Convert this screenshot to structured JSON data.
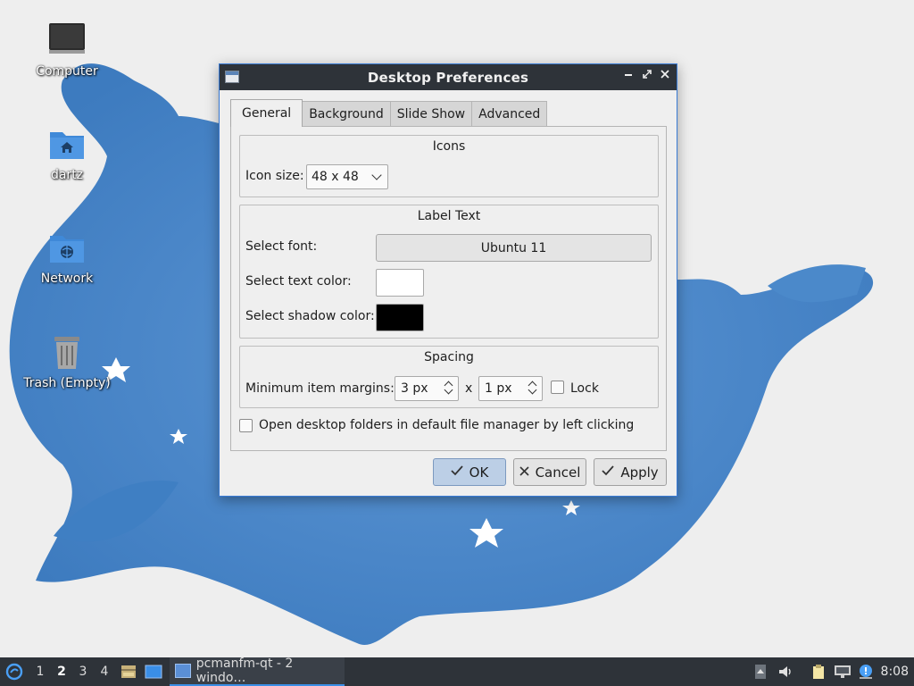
{
  "desktop": {
    "icons": [
      {
        "label": "Computer"
      },
      {
        "label": "dartz"
      },
      {
        "label": "Network"
      },
      {
        "label": "Trash (Empty)"
      }
    ]
  },
  "dialog": {
    "title": "Desktop Preferences",
    "tabs": [
      "General",
      "Background",
      "Slide Show",
      "Advanced"
    ],
    "active_tab": "General",
    "icons_group": {
      "title": "Icons",
      "icon_size_label": "Icon size:",
      "icon_size_value": "48 x 48"
    },
    "label_text_group": {
      "title": "Label Text",
      "font_label": "Select font:",
      "font_value": "Ubuntu 11",
      "text_color_label": "Select text color:",
      "text_color": "#ffffff",
      "shadow_color_label": "Select shadow color:",
      "shadow_color": "#000000"
    },
    "spacing_group": {
      "title": "Spacing",
      "margins_label": "Minimum item margins:",
      "margin_x": "3 px",
      "separator": "x",
      "margin_y": "1 px",
      "lock_label": "Lock",
      "lock_checked": false
    },
    "open_folders_label": "Open desktop folders in default file manager by left clicking",
    "open_folders_checked": false,
    "buttons": {
      "ok": "OK",
      "cancel": "Cancel",
      "apply": "Apply"
    }
  },
  "taskbar": {
    "workspaces": [
      "1",
      "2",
      "3",
      "4"
    ],
    "current_workspace": "2",
    "task_label": "pcmanfm-qt - 2 windo…",
    "clock": "8:08"
  },
  "colors": {
    "panel": "#2e3339",
    "accent": "#3a8ee6",
    "wallpaper_blue": "#4a86c8"
  }
}
